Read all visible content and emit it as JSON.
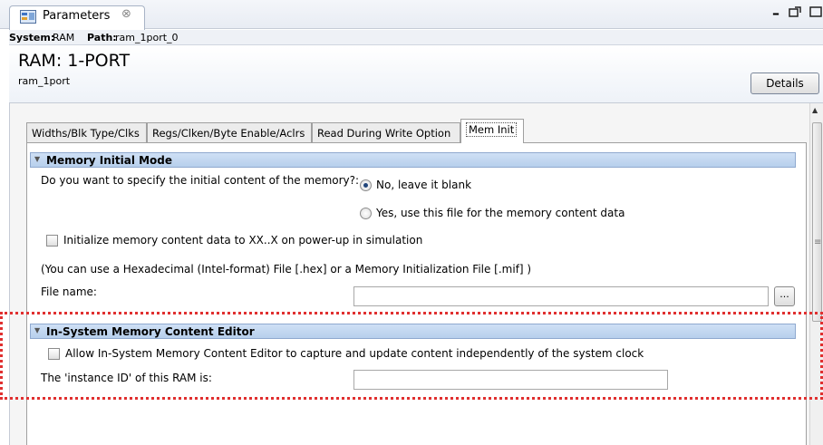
{
  "view_tab": {
    "title": "Parameters",
    "close": "⊗"
  },
  "window_controls": {
    "minimize": "–"
  },
  "system_bar": {
    "system_label": "System:",
    "system_value": "RAM",
    "path_label": "Path:",
    "path_value": "ram_1port_0"
  },
  "header": {
    "title": "RAM: 1-PORT",
    "instance": "ram_1port",
    "details_button": "Details"
  },
  "tabs": [
    {
      "label": "Widths/Blk Type/Clks"
    },
    {
      "label": "Regs/Clken/Byte Enable/Aclrs"
    },
    {
      "label": "Read During Write Option"
    },
    {
      "label": "Mem Init"
    }
  ],
  "memory_initial_mode": {
    "header": "Memory Initial Mode",
    "question": "Do you want to specify the initial content of the memory?:",
    "option_blank": "No, leave it blank",
    "option_file": "Yes, use this file for the memory content data",
    "selected": "No, leave it blank",
    "init_checkbox": "Initialize memory content data to XX..X on power-up in simulation",
    "init_checked": false,
    "hint": "(You can use a Hexadecimal (Intel-format) File [.hex] or a Memory Initialization File [.mif] )",
    "file_label": "File name:",
    "file_value": "",
    "browse_button": "..."
  },
  "in_system_editor": {
    "header": "In-System Memory Content Editor",
    "checkbox_label": "Allow In-System Memory Content Editor to capture and update content independently of the system clock",
    "checked": false,
    "instance_id_label": "The 'instance ID' of this RAM is:",
    "instance_id_value": ""
  },
  "colors": {
    "highlight": "#e03030",
    "section_header": "#b7cfec"
  }
}
